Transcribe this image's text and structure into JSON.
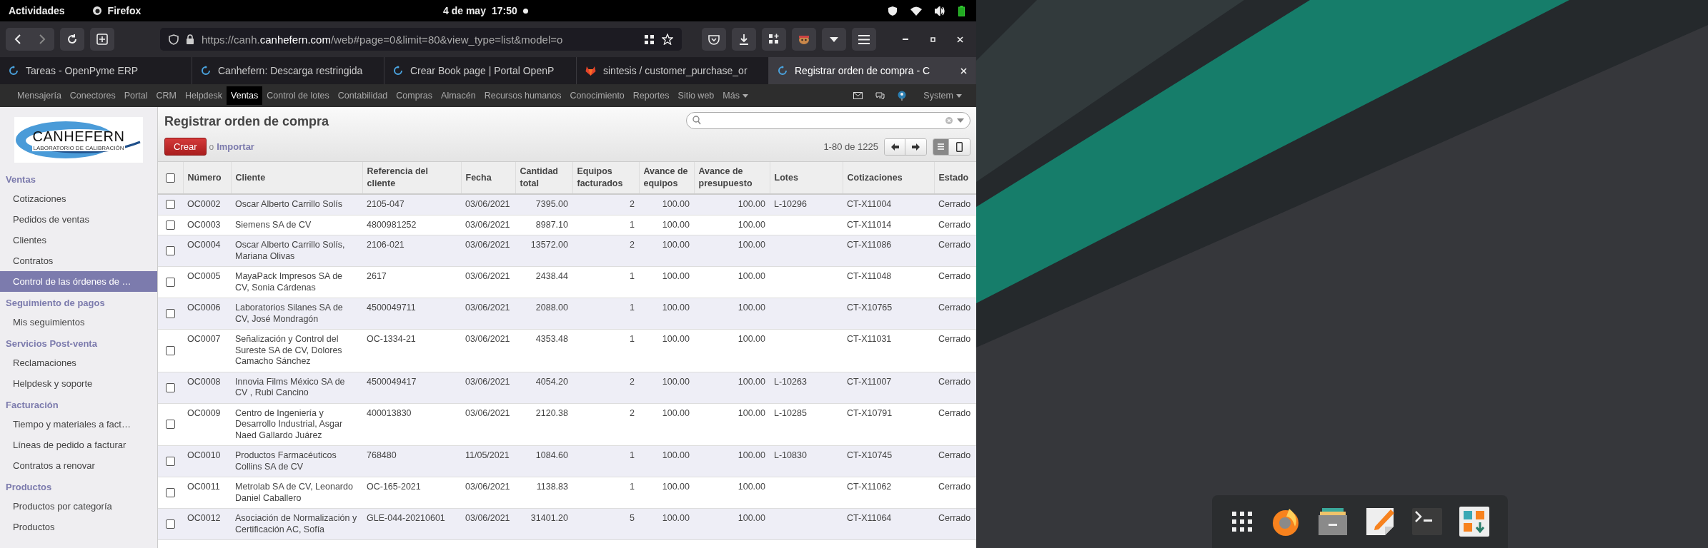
{
  "top_bar": {
    "activities": "Actividades",
    "app_name": "Firefox",
    "date": "4 de may",
    "time": "17:50"
  },
  "browser": {
    "url_scheme": "https://canh.",
    "url_domain": "canhefern.com",
    "url_path": "/web#page=0&limit=80&view_type=list&model=o"
  },
  "tabs": [
    {
      "title": "Tareas - OpenPyme ERP",
      "kind": "odoo",
      "selected": false
    },
    {
      "title": "Canhefern: Descarga restringida",
      "kind": "odoo",
      "selected": false
    },
    {
      "title": "Crear Book page | Portal OpenP",
      "kind": "odoo",
      "selected": false
    },
    {
      "title": "sintesis / customer_purchase_or",
      "kind": "gitlab",
      "selected": false
    },
    {
      "title": "Registrar orden de compra - C",
      "kind": "odoo",
      "selected": true
    }
  ],
  "app_menu": {
    "items": [
      {
        "label": "Mensajería",
        "selected": false
      },
      {
        "label": "Conectores",
        "selected": false
      },
      {
        "label": "Portal",
        "selected": false
      },
      {
        "label": "CRM",
        "selected": false
      },
      {
        "label": "Helpdesk",
        "selected": false
      },
      {
        "label": "Ventas",
        "selected": true
      },
      {
        "label": "Control de lotes",
        "selected": false
      },
      {
        "label": "Contabilidad",
        "selected": false
      },
      {
        "label": "Compras",
        "selected": false
      },
      {
        "label": "Almacén",
        "selected": false
      },
      {
        "label": "Recursos humanos",
        "selected": false
      },
      {
        "label": "Conocimiento",
        "selected": false
      },
      {
        "label": "Reportes",
        "selected": false
      },
      {
        "label": "Sitio web",
        "selected": false
      },
      {
        "label": "Más",
        "selected": false
      }
    ],
    "user": "System"
  },
  "sidebar": {
    "logo_text": "CANHEFERN",
    "logo_tagline": "LABORATORIO DE CALIBRACIÓN",
    "sections": [
      {
        "title": "Ventas",
        "items": [
          {
            "label": "Cotizaciones",
            "selected": false
          },
          {
            "label": "Pedidos de ventas",
            "selected": false
          },
          {
            "label": "Clientes",
            "selected": false
          },
          {
            "label": "Contratos",
            "selected": false
          },
          {
            "label": "Control de las órdenes de …",
            "selected": true
          }
        ]
      },
      {
        "title": "Seguimiento de pagos",
        "items": [
          {
            "label": "Mis seguimientos",
            "selected": false
          }
        ]
      },
      {
        "title": "Servicios Post-venta",
        "items": [
          {
            "label": "Reclamaciones",
            "selected": false
          },
          {
            "label": "Helpdesk y soporte",
            "selected": false
          }
        ]
      },
      {
        "title": "Facturación",
        "items": [
          {
            "label": "Tiempo y materiales a fact…",
            "selected": false
          },
          {
            "label": "Líneas de pedido a facturar",
            "selected": false
          },
          {
            "label": "Contratos a renovar",
            "selected": false
          }
        ]
      },
      {
        "title": "Productos",
        "items": [
          {
            "label": "Productos por categoría",
            "selected": false
          },
          {
            "label": "Productos",
            "selected": false
          }
        ]
      }
    ]
  },
  "page": {
    "title": "Registrar orden de compra",
    "create_button": "Crear",
    "or_text": "o",
    "import_link": "Importar",
    "pager": "1-80 de 1225"
  },
  "table": {
    "select_all_checked": false,
    "columns": [
      {
        "label": "Número"
      },
      {
        "label": "Cliente"
      },
      {
        "label": "Referencia del cliente"
      },
      {
        "label": "Fecha"
      },
      {
        "label": "Cantidad total"
      },
      {
        "label": "Equipos facturados"
      },
      {
        "label": "Avance de equipos"
      },
      {
        "label": "Avance de presupuesto"
      },
      {
        "label": "Lotes"
      },
      {
        "label": "Cotizaciones"
      },
      {
        "label": "Estado"
      }
    ],
    "rows": [
      {
        "checked": false,
        "cells": [
          "OC0002",
          "Oscar Alberto Carrillo Solís",
          "2105-047",
          "03/06/2021",
          "7395.00",
          "2",
          "100.00",
          "100.00",
          "L-10296",
          "CT-X11004",
          "Cerrado"
        ]
      },
      {
        "checked": false,
        "cells": [
          "OC0003",
          "Siemens SA de CV",
          "4800981252",
          "03/06/2021",
          "8987.10",
          "1",
          "100.00",
          "100.00",
          "",
          "CT-X11014",
          "Cerrado"
        ]
      },
      {
        "checked": false,
        "cells": [
          "OC0004",
          "Oscar Alberto Carrillo Solís, Mariana Olivas",
          "2106-021",
          "03/06/2021",
          "13572.00",
          "2",
          "100.00",
          "100.00",
          "",
          "CT-X11086",
          "Cerrado"
        ]
      },
      {
        "checked": false,
        "cells": [
          "OC0005",
          "MayaPack Impresos SA de CV, Sonia Cárdenas",
          "2617",
          "03/06/2021",
          "2438.44",
          "1",
          "100.00",
          "100.00",
          "",
          "CT-X11048",
          "Cerrado"
        ]
      },
      {
        "checked": false,
        "cells": [
          "OC0006",
          "Laboratorios Silanes SA de CV, José Mondragón",
          "4500049711",
          "03/06/2021",
          "2088.00",
          "1",
          "100.00",
          "100.00",
          "",
          "CT-X10765",
          "Cerrado"
        ]
      },
      {
        "checked": false,
        "cells": [
          "OC0007",
          "Señalización y Control del Sureste SA de CV, Dolores Camacho Sánchez",
          "OC-1334-21",
          "03/06/2021",
          "4353.48",
          "1",
          "100.00",
          "100.00",
          "",
          "CT-X11031",
          "Cerrado"
        ]
      },
      {
        "checked": false,
        "cells": [
          "OC0008",
          "Innovia Films México SA de CV , Rubi Cancino",
          "4500049417",
          "03/06/2021",
          "4054.20",
          "2",
          "100.00",
          "100.00",
          "L-10263",
          "CT-X11007",
          "Cerrado"
        ]
      },
      {
        "checked": false,
        "cells": [
          "OC0009",
          "Centro de Ingeniería y Desarrollo Industrial, Asgar Naed Gallardo Juárez",
          "400013830",
          "03/06/2021",
          "2120.38",
          "2",
          "100.00",
          "100.00",
          "L-10285",
          "CT-X10791",
          "Cerrado"
        ]
      },
      {
        "checked": false,
        "cells": [
          "OC0010",
          "Productos Farmacéuticos Collins SA de CV",
          "768480",
          "11/05/2021",
          "1084.60",
          "1",
          "100.00",
          "100.00",
          "L-10830",
          "CT-X10745",
          "Cerrado"
        ]
      },
      {
        "checked": false,
        "cells": [
          "OC0011",
          "Metrolab SA de CV, Leonardo Daniel Caballero",
          "OC-165-2021",
          "03/06/2021",
          "1138.83",
          "1",
          "100.00",
          "100.00",
          "",
          "CT-X11062",
          "Cerrado"
        ]
      },
      {
        "checked": false,
        "cells": [
          "OC0012",
          "Asociación de Normalización y Certificación AC, Sofía",
          "GLE-044-20210601",
          "03/06/2021",
          "31401.20",
          "5",
          "100.00",
          "100.00",
          "",
          "CT-X11064",
          "Cerrado"
        ]
      }
    ]
  }
}
